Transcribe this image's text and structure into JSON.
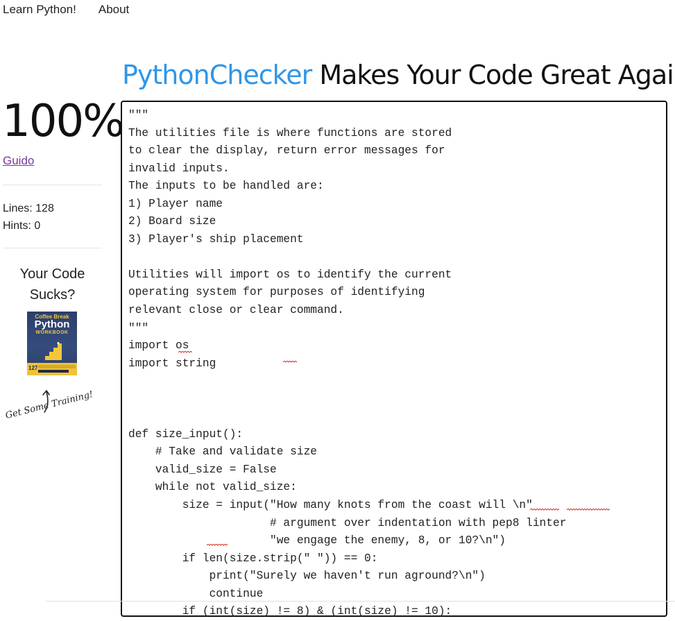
{
  "nav": {
    "home": "Learn Python!",
    "about": "About"
  },
  "headline": {
    "brand": "PythonChecker",
    "rest": " Makes Your Code Great Again"
  },
  "result": {
    "score": "100%",
    "author": "Guido",
    "lines": "Lines: 128",
    "hints": "Hints: 0"
  },
  "promo": {
    "line1": "Your Code",
    "line2": "Sucks?",
    "book_top": "Coffee Break",
    "book_title": "Python",
    "book_sub": "WORKBOOK",
    "book_count": "127",
    "cta": "Get Some Training!"
  },
  "code_lines": [
    "\"\"\"",
    "The utilities file is where functions are stored",
    "to clear the display, return error messages for",
    "invalid inputs.",
    "The inputs to be handled are:",
    "1) Player name",
    "2) Board size",
    "3) Player's ship placement",
    "",
    "Utilities will import os to identify the current",
    "operating system for purposes of identifying",
    "relevant close or clear command.",
    "\"\"\"",
    "import os",
    "import string",
    "",
    "",
    "",
    "def size_input():",
    "    # Take and validate size",
    "    valid_size = False",
    "    while not valid_size:",
    "        size = input(\"How many knots from the coast will \\n\"",
    "                     # argument over indentation with pep8 linter",
    "                     \"we engage the enemy, 8, or 10?\\n\")",
    "        if len(size.strip(\" \")) == 0:",
    "            print(\"Surely we haven't run aground?\\n\")",
    "            continue",
    "        if (int(size) != 8) & (int(size) != 10):"
  ],
  "colors": {
    "brand": "#2f96e8",
    "link": "#7a3a98",
    "spellcheck": "#d93025"
  }
}
